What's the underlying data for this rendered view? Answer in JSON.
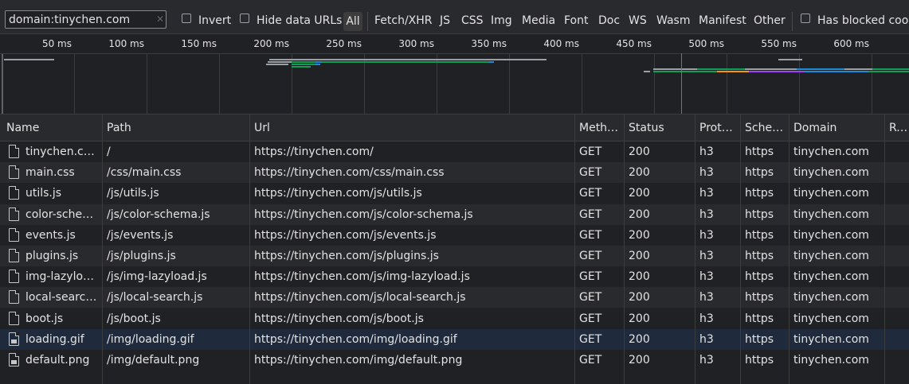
{
  "filter": {
    "value": "domain:tinychen.com",
    "invert_label": "Invert",
    "hide_data_urls_label": "Hide data URLs",
    "has_blocked_label": "Has blocked cook",
    "types": [
      "All",
      "Fetch/XHR",
      "JS",
      "CSS",
      "Img",
      "Media",
      "Font",
      "Doc",
      "WS",
      "Wasm",
      "Manifest",
      "Other"
    ]
  },
  "timeline": {
    "ticks": [
      "50 ms",
      "100 ms",
      "150 ms",
      "200 ms",
      "250 ms",
      "300 ms",
      "350 ms",
      "400 ms",
      "450 ms",
      "500 ms",
      "550 ms",
      "600 ms"
    ],
    "bar_colors": {
      "gray": "#9aa0a6",
      "green": "#0f9d58",
      "blue": "#1a8cd8",
      "orange": "#f29900",
      "purple": "#a142f4",
      "waiting": "#5f6368"
    }
  },
  "columns": [
    "Name",
    "Path",
    "Url",
    "Meth…",
    "Status",
    "Prot…",
    "Sche…",
    "Domain",
    "Rem"
  ],
  "rows": [
    {
      "name": "tinychen.com",
      "path": "/",
      "url": "https://tinychen.com/",
      "method": "GET",
      "status": "200",
      "protocol": "h3",
      "scheme": "https",
      "domain": "tinychen.com",
      "icon": "document-icon"
    },
    {
      "name": "main.css",
      "path": "/css/main.css",
      "url": "https://tinychen.com/css/main.css",
      "method": "GET",
      "status": "200",
      "protocol": "h3",
      "scheme": "https",
      "domain": "tinychen.com",
      "icon": "document-icon"
    },
    {
      "name": "utils.js",
      "path": "/js/utils.js",
      "url": "https://tinychen.com/js/utils.js",
      "method": "GET",
      "status": "200",
      "protocol": "h3",
      "scheme": "https",
      "domain": "tinychen.com",
      "icon": "document-icon"
    },
    {
      "name": "color-sche…",
      "path": "/js/color-schema.js",
      "url": "https://tinychen.com/js/color-schema.js",
      "method": "GET",
      "status": "200",
      "protocol": "h3",
      "scheme": "https",
      "domain": "tinychen.com",
      "icon": "document-icon"
    },
    {
      "name": "events.js",
      "path": "/js/events.js",
      "url": "https://tinychen.com/js/events.js",
      "method": "GET",
      "status": "200",
      "protocol": "h3",
      "scheme": "https",
      "domain": "tinychen.com",
      "icon": "document-icon"
    },
    {
      "name": "plugins.js",
      "path": "/js/plugins.js",
      "url": "https://tinychen.com/js/plugins.js",
      "method": "GET",
      "status": "200",
      "protocol": "h3",
      "scheme": "https",
      "domain": "tinychen.com",
      "icon": "document-icon"
    },
    {
      "name": "img-lazyloa…",
      "path": "/js/img-lazyload.js",
      "url": "https://tinychen.com/js/img-lazyload.js",
      "method": "GET",
      "status": "200",
      "protocol": "h3",
      "scheme": "https",
      "domain": "tinychen.com",
      "icon": "document-icon"
    },
    {
      "name": "local-search…",
      "path": "/js/local-search.js",
      "url": "https://tinychen.com/js/local-search.js",
      "method": "GET",
      "status": "200",
      "protocol": "h3",
      "scheme": "https",
      "domain": "tinychen.com",
      "icon": "document-icon"
    },
    {
      "name": "boot.js",
      "path": "/js/boot.js",
      "url": "https://tinychen.com/js/boot.js",
      "method": "GET",
      "status": "200",
      "protocol": "h3",
      "scheme": "https",
      "domain": "tinychen.com",
      "icon": "document-icon"
    },
    {
      "name": "loading.gif",
      "path": "/img/loading.gif",
      "url": "https://tinychen.com/img/loading.gif",
      "method": "GET",
      "status": "200",
      "protocol": "h3",
      "scheme": "https",
      "domain": "tinychen.com",
      "icon": "image-file-icon"
    },
    {
      "name": "default.png",
      "path": "/img/default.png",
      "url": "https://tinychen.com/img/default.png",
      "method": "GET",
      "status": "200",
      "protocol": "h3",
      "scheme": "https",
      "domain": "tinychen.com",
      "icon": "image-file-icon"
    }
  ]
}
